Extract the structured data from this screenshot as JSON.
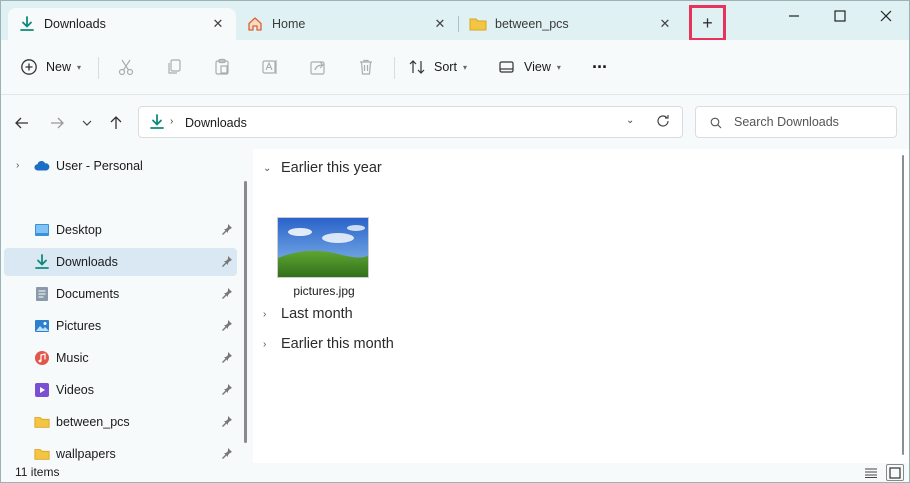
{
  "tabs": [
    {
      "label": "Downloads",
      "icon": "download-arrow-icon",
      "active": true
    },
    {
      "label": "Home",
      "icon": "home-icon",
      "active": false
    },
    {
      "label": "between_pcs",
      "icon": "folder-icon",
      "active": false
    }
  ],
  "new_tab_label": "+",
  "toolbar": {
    "new_label": "New",
    "sort_label": "Sort",
    "view_label": "View",
    "more_label": "···"
  },
  "address": {
    "crumb": "Downloads",
    "search_placeholder": "Search Downloads"
  },
  "sidebar": {
    "cloud_label": "User - Personal",
    "items": [
      {
        "label": "Desktop",
        "icon": "desktop-icon"
      },
      {
        "label": "Downloads",
        "icon": "download-arrow-icon",
        "selected": true
      },
      {
        "label": "Documents",
        "icon": "documents-icon"
      },
      {
        "label": "Pictures",
        "icon": "pictures-icon"
      },
      {
        "label": "Music",
        "icon": "music-icon"
      },
      {
        "label": "Videos",
        "icon": "videos-icon"
      },
      {
        "label": "between_pcs",
        "icon": "folder-icon"
      },
      {
        "label": "wallpapers",
        "icon": "folder-icon"
      }
    ]
  },
  "content": {
    "groups": [
      {
        "label": "Earlier this year",
        "expanded": true
      },
      {
        "label": "Last month",
        "expanded": false
      },
      {
        "label": "Earlier this month",
        "expanded": false
      }
    ],
    "files": [
      {
        "name": "pictures.jpg"
      }
    ]
  },
  "status": {
    "item_count": "11 items"
  },
  "colors": {
    "accent": "#0f7a9c",
    "highlight_border": "#e8335a",
    "selected_bg": "#d9e8f3",
    "titlebar_bg": "#dff1f3",
    "folder_yellow": "#f4c542"
  }
}
